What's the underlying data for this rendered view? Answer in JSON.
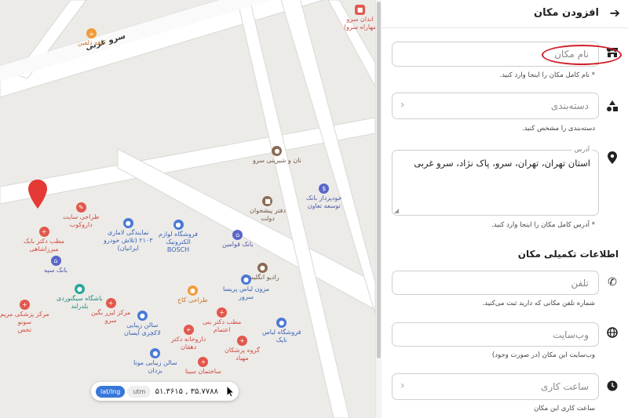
{
  "map": {
    "street_label": "سرو غربی",
    "cafe_label": "کافه دلفین",
    "top_right_poi": "اندان سرو\nمهاراه سرو)",
    "coord_modes": [
      "lat/lng",
      "utm"
    ],
    "coordinates": "۳۵.۷۷۸۸ , ۵۱.۳۶۱۵",
    "pois": [
      {
        "label": "نان و شیرینی سرو",
        "color": "brown"
      },
      {
        "label": "خودپرداز بانک\nتوسعه تعاون",
        "color": "navy"
      },
      {
        "label": "دفتر پیشخوان\nدولت",
        "color": "brown"
      },
      {
        "label": "طراحی سایت\nداروکوب",
        "color": "red"
      },
      {
        "label": "مطب دکتر بابک\nمیرزاشاهی",
        "color": "red"
      },
      {
        "label": "بانک سپه",
        "color": "navy"
      },
      {
        "label": "نمایندگی لاماری\n۲۱۰۳ (تلاش خودرو\nایرانیان)",
        "color": "blue"
      },
      {
        "label": "فروشگاه لوازم\nالکترونیک\nBOSCH",
        "color": "blue"
      },
      {
        "label": "بانک قوامین",
        "color": "navy"
      },
      {
        "label": "رادیو انگلیش",
        "color": "brown"
      },
      {
        "label": "مزون لباس پریسا\nسرور",
        "color": "blue"
      },
      {
        "label": "باشگاه سیگنوردی\nبلدرلند",
        "color": "teal"
      },
      {
        "label": "طراحی کاج",
        "color": "orange"
      },
      {
        "label": "مرکز لیزر بگین\nسرو",
        "color": "red"
      },
      {
        "label": "مرکز پزشکی مریم\nسونو\nتخص",
        "color": "red"
      },
      {
        "label": "سالن زیبایی\nلاکچری آیسان",
        "color": "blue"
      },
      {
        "label": "مطب دکتر بنی\nاعتمام",
        "color": "red"
      },
      {
        "label": "فروشگاه لباس\nنایک",
        "color": "blue"
      },
      {
        "label": "داروخانه دکتر\nدهقان",
        "color": "red"
      },
      {
        "label": "گروه پزشکان\nمهیاد",
        "color": "red"
      },
      {
        "label": "سالن زیبایی مونا\nبزدان",
        "color": "blue"
      },
      {
        "label": "ساختمان سینا",
        "color": "red"
      }
    ]
  },
  "panel": {
    "title": "افزودن مکان",
    "name_placeholder": "نام مکان",
    "name_hint": "* نام کامل مکان را اینجا وارد کنید.",
    "category_placeholder": "دسته‌بندی",
    "category_hint": "دسته‌بندی را مشخص کنید.",
    "address_label": "آدرس",
    "address_value": "استان تهران، تهران، سرو، پاک نژاد، سرو غربی",
    "address_hint": "* آدرس کامل مکان را اینجا وارد کنید.",
    "section_title": "اطلاعات تکمیلی مکان",
    "phone_placeholder": "تلفن",
    "phone_hint": "شماره تلفن مکانی که دارید ثبت می‌کنید.",
    "website_placeholder": "وب‌سایت",
    "website_hint": "وب‌سایت این مکان (در صورت وجود)",
    "hours_placeholder": "ساعت کاری",
    "hours_hint": "ساعت کاری این مکان"
  },
  "colors": {
    "accent": "#3777d9",
    "marker": "#e53935",
    "annotation": "#d0212a"
  }
}
